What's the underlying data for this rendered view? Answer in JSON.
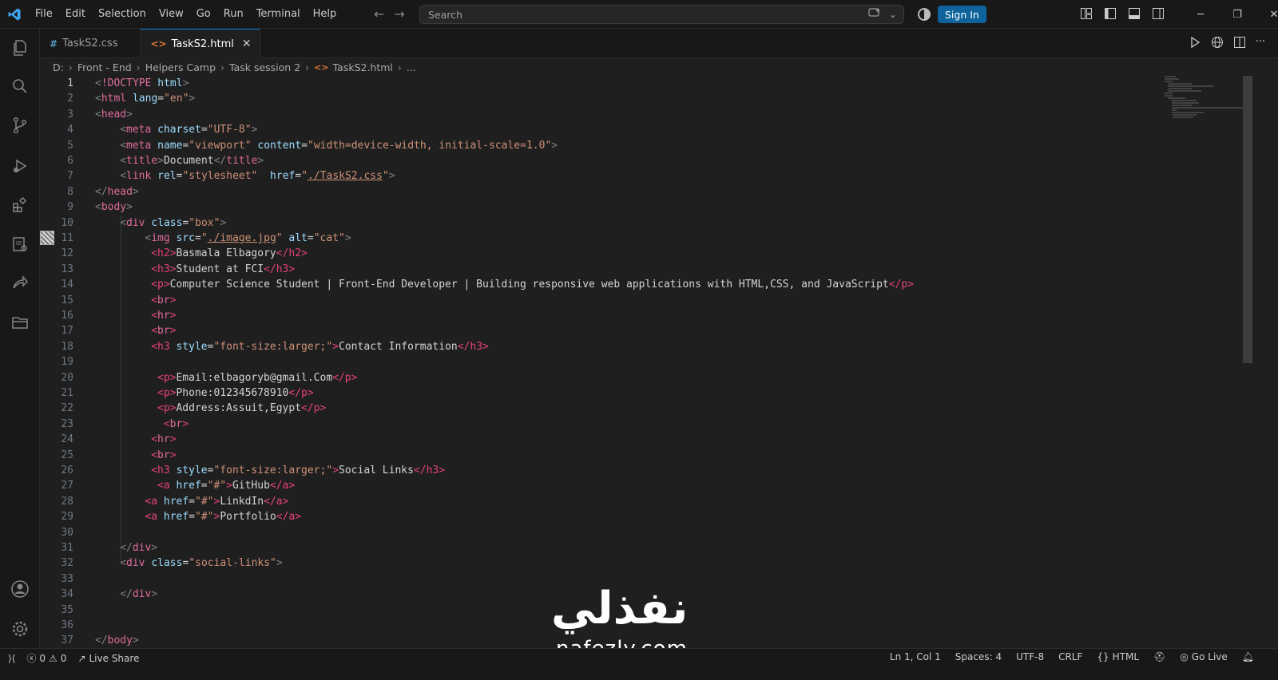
{
  "menu": [
    "File",
    "Edit",
    "Selection",
    "View",
    "Go",
    "Run",
    "Terminal",
    "Help"
  ],
  "search": {
    "placeholder": "Search"
  },
  "signin_label": "Sign In",
  "tabs": [
    {
      "label": "TaskS2.css",
      "icon": "#",
      "active": false
    },
    {
      "label": "TaskS2.html",
      "icon": "<>",
      "active": true
    }
  ],
  "breadcrumb": [
    "D:",
    "Front - End",
    "Helpers Camp",
    "Task session 2",
    "TaskS2.html",
    "..."
  ],
  "colors": {
    "accent": "#0078d4",
    "signin": "#0e639c",
    "tag": "#e5427d",
    "attr": "#9cdcfe",
    "string": "#ce9178"
  },
  "code_lines": [
    {
      "n": "1",
      "indent": 0,
      "tokens": [
        [
          "p",
          "<"
        ],
        [
          "t",
          "!DOCTYPE"
        ],
        [
          "a",
          " html"
        ],
        [
          "p",
          ">"
        ]
      ]
    },
    {
      "n": "2",
      "indent": 0,
      "tokens": [
        [
          "p",
          "<"
        ],
        [
          "t",
          "html"
        ],
        [
          "a",
          " lang"
        ],
        [
          "x",
          "="
        ],
        [
          "s",
          "\"en\""
        ],
        [
          "p",
          ">"
        ]
      ]
    },
    {
      "n": "3",
      "indent": 0,
      "tokens": [
        [
          "p",
          "<"
        ],
        [
          "t",
          "head"
        ],
        [
          "p",
          ">"
        ]
      ]
    },
    {
      "n": "4",
      "indent": 4,
      "tokens": [
        [
          "p",
          "<"
        ],
        [
          "t",
          "meta"
        ],
        [
          "a",
          " charset"
        ],
        [
          "x",
          "="
        ],
        [
          "s",
          "\"UTF-8\""
        ],
        [
          "p",
          ">"
        ]
      ]
    },
    {
      "n": "5",
      "indent": 4,
      "tokens": [
        [
          "p",
          "<"
        ],
        [
          "t",
          "meta"
        ],
        [
          "a",
          " name"
        ],
        [
          "x",
          "="
        ],
        [
          "s",
          "\"viewport\""
        ],
        [
          "a",
          " content"
        ],
        [
          "x",
          "="
        ],
        [
          "s",
          "\"width=device-width, initial-scale=1.0\""
        ],
        [
          "p",
          ">"
        ]
      ]
    },
    {
      "n": "6",
      "indent": 4,
      "tokens": [
        [
          "p",
          "<"
        ],
        [
          "t",
          "title"
        ],
        [
          "p",
          ">"
        ],
        [
          "x",
          "Document"
        ],
        [
          "p",
          "</"
        ],
        [
          "t",
          "title"
        ],
        [
          "p",
          ">"
        ]
      ]
    },
    {
      "n": "7",
      "indent": 4,
      "tokens": [
        [
          "p",
          "<"
        ],
        [
          "t",
          "link"
        ],
        [
          "a",
          " rel"
        ],
        [
          "x",
          "="
        ],
        [
          "s",
          "\"stylesheet\""
        ],
        [
          "a",
          "  href"
        ],
        [
          "x",
          "="
        ],
        [
          "s",
          "\""
        ],
        [
          "l",
          "./TaskS2.css"
        ],
        [
          "s",
          "\""
        ],
        [
          "p",
          ">"
        ]
      ]
    },
    {
      "n": "8",
      "indent": 0,
      "tokens": [
        [
          "p",
          "</"
        ],
        [
          "t",
          "head"
        ],
        [
          "p",
          ">"
        ]
      ]
    },
    {
      "n": "9",
      "indent": 0,
      "tokens": [
        [
          "p",
          "<"
        ],
        [
          "t",
          "body"
        ],
        [
          "p",
          ">"
        ]
      ]
    },
    {
      "n": "10",
      "indent": 4,
      "tokens": [
        [
          "p",
          "<"
        ],
        [
          "t",
          "div"
        ],
        [
          "a",
          " class"
        ],
        [
          "x",
          "="
        ],
        [
          "s",
          "\"box\""
        ],
        [
          "p",
          ">"
        ]
      ]
    },
    {
      "n": "11",
      "indent": 8,
      "tokens": [
        [
          "p",
          "<"
        ],
        [
          "t",
          "img"
        ],
        [
          "a",
          " src"
        ],
        [
          "x",
          "="
        ],
        [
          "s",
          "\""
        ],
        [
          "l",
          "./image.jpg"
        ],
        [
          "s",
          "\""
        ],
        [
          "a",
          " alt"
        ],
        [
          "x",
          "="
        ],
        [
          "s",
          "\"cat\""
        ],
        [
          "p",
          ">"
        ]
      ]
    },
    {
      "n": "12",
      "indent": 9,
      "tokens": [
        [
          "q",
          "<h2>"
        ],
        [
          "x",
          "Basmala Elbagory"
        ],
        [
          "q",
          "</h2>"
        ]
      ]
    },
    {
      "n": "13",
      "indent": 9,
      "tokens": [
        [
          "q",
          "<h3>"
        ],
        [
          "x",
          "Student at FCI"
        ],
        [
          "q",
          "</h3>"
        ]
      ]
    },
    {
      "n": "14",
      "indent": 9,
      "tokens": [
        [
          "q",
          "<p>"
        ],
        [
          "x",
          "Computer Science Student | Front-End Developer | Building responsive web applications with HTML,CSS, and JavaScript"
        ],
        [
          "q",
          "</p>"
        ]
      ]
    },
    {
      "n": "15",
      "indent": 9,
      "tokens": [
        [
          "q",
          "<"
        ],
        [
          "t",
          "br"
        ],
        [
          "q",
          ">"
        ]
      ]
    },
    {
      "n": "16",
      "indent": 9,
      "tokens": [
        [
          "q",
          "<"
        ],
        [
          "t",
          "hr"
        ],
        [
          "q",
          ">"
        ]
      ]
    },
    {
      "n": "17",
      "indent": 9,
      "tokens": [
        [
          "q",
          "<"
        ],
        [
          "t",
          "br"
        ],
        [
          "q",
          ">"
        ]
      ]
    },
    {
      "n": "18",
      "indent": 9,
      "tokens": [
        [
          "q",
          "<h3"
        ],
        [
          "a",
          " style"
        ],
        [
          "x",
          "="
        ],
        [
          "s",
          "\"font-size:larger;\""
        ],
        [
          "q",
          ">"
        ],
        [
          "x",
          "Contact Information"
        ],
        [
          "q",
          "</h3>"
        ]
      ]
    },
    {
      "n": "19",
      "indent": 0,
      "tokens": []
    },
    {
      "n": "20",
      "indent": 10,
      "tokens": [
        [
          "q",
          "<p>"
        ],
        [
          "x",
          "Email:elbagoryb@gmail.Com"
        ],
        [
          "q",
          "</p>"
        ]
      ]
    },
    {
      "n": "21",
      "indent": 10,
      "tokens": [
        [
          "q",
          "<p>"
        ],
        [
          "x",
          "Phone:012345678910"
        ],
        [
          "q",
          "</p>"
        ]
      ]
    },
    {
      "n": "22",
      "indent": 10,
      "tokens": [
        [
          "q",
          "<p>"
        ],
        [
          "x",
          "Address:Assuit,Egypt"
        ],
        [
          "q",
          "</p>"
        ]
      ]
    },
    {
      "n": "23",
      "indent": 11,
      "tokens": [
        [
          "q",
          "<"
        ],
        [
          "t",
          "br"
        ],
        [
          "q",
          ">"
        ]
      ]
    },
    {
      "n": "24",
      "indent": 9,
      "tokens": [
        [
          "q",
          "<"
        ],
        [
          "t",
          "hr"
        ],
        [
          "q",
          ">"
        ]
      ]
    },
    {
      "n": "25",
      "indent": 9,
      "tokens": [
        [
          "q",
          "<"
        ],
        [
          "t",
          "br"
        ],
        [
          "q",
          ">"
        ]
      ]
    },
    {
      "n": "26",
      "indent": 9,
      "tokens": [
        [
          "q",
          "<h3"
        ],
        [
          "a",
          " style"
        ],
        [
          "x",
          "="
        ],
        [
          "s",
          "\"font-size:larger;\""
        ],
        [
          "q",
          ">"
        ],
        [
          "x",
          "Social Links"
        ],
        [
          "q",
          "</h3>"
        ]
      ]
    },
    {
      "n": "27",
      "indent": 10,
      "tokens": [
        [
          "q",
          "<a"
        ],
        [
          "a",
          " href"
        ],
        [
          "x",
          "="
        ],
        [
          "s",
          "\"#\""
        ],
        [
          "q",
          ">"
        ],
        [
          "x",
          "GitHub"
        ],
        [
          "q",
          "</a>"
        ]
      ]
    },
    {
      "n": "28",
      "indent": 8,
      "tokens": [
        [
          "q",
          "<a"
        ],
        [
          "a",
          " href"
        ],
        [
          "x",
          "="
        ],
        [
          "s",
          "\"#\""
        ],
        [
          "q",
          ">"
        ],
        [
          "x",
          "LinkdIn"
        ],
        [
          "q",
          "</a>"
        ]
      ]
    },
    {
      "n": "29",
      "indent": 8,
      "tokens": [
        [
          "q",
          "<a"
        ],
        [
          "a",
          " href"
        ],
        [
          "x",
          "="
        ],
        [
          "s",
          "\"#\""
        ],
        [
          "q",
          ">"
        ],
        [
          "x",
          "Portfolio"
        ],
        [
          "q",
          "</a>"
        ]
      ]
    },
    {
      "n": "30",
      "indent": 0,
      "tokens": []
    },
    {
      "n": "31",
      "indent": 4,
      "tokens": [
        [
          "p",
          "</"
        ],
        [
          "t",
          "div"
        ],
        [
          "p",
          ">"
        ]
      ]
    },
    {
      "n": "32",
      "indent": 4,
      "tokens": [
        [
          "p",
          "<"
        ],
        [
          "t",
          "div"
        ],
        [
          "a",
          " class"
        ],
        [
          "x",
          "="
        ],
        [
          "s",
          "\"social-links\""
        ],
        [
          "p",
          ">"
        ]
      ]
    },
    {
      "n": "33",
      "indent": 0,
      "tokens": []
    },
    {
      "n": "34",
      "indent": 4,
      "tokens": [
        [
          "p",
          "</"
        ],
        [
          "t",
          "div"
        ],
        [
          "p",
          ">"
        ]
      ]
    },
    {
      "n": "35",
      "indent": 0,
      "tokens": []
    },
    {
      "n": "36",
      "indent": 0,
      "tokens": []
    },
    {
      "n": "37",
      "indent": 0,
      "tokens": [
        [
          "p",
          "</"
        ],
        [
          "t",
          "body"
        ],
        [
          "p",
          ">"
        ]
      ]
    }
  ],
  "watermark": {
    "arabic": "نفذلي",
    "latin": "nafezly.com"
  },
  "status": {
    "errors": "0",
    "warnings": "0",
    "live_share": "Live Share",
    "position": "Ln 1, Col 1",
    "spaces": "Spaces: 4",
    "encoding": "UTF-8",
    "eol": "CRLF",
    "language": "HTML",
    "go_live": "Go Live"
  }
}
